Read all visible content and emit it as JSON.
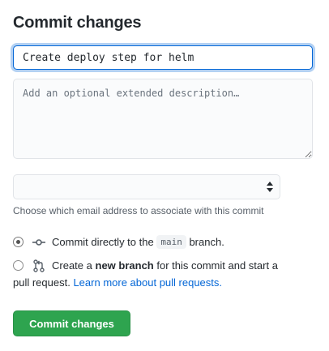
{
  "title": "Commit changes",
  "summary": {
    "value": "Create deploy step for helm"
  },
  "description": {
    "placeholder": "Add an optional extended description…"
  },
  "email": {
    "selected": "",
    "note": "Choose which email address to associate with this commit"
  },
  "options": {
    "direct": {
      "checked": true,
      "prefix": "Commit directly to the",
      "branch": "main",
      "suffix": "branch."
    },
    "new_branch": {
      "checked": false,
      "prefix": "Create a",
      "bold": "new branch",
      "suffix": "for this commit and start a",
      "line2": "pull request.",
      "link": "Learn more about pull requests."
    }
  },
  "button": {
    "label": "Commit changes"
  },
  "colors": {
    "primary": "#2ea44f",
    "link": "#0366d6",
    "focus": "#0366d6"
  }
}
